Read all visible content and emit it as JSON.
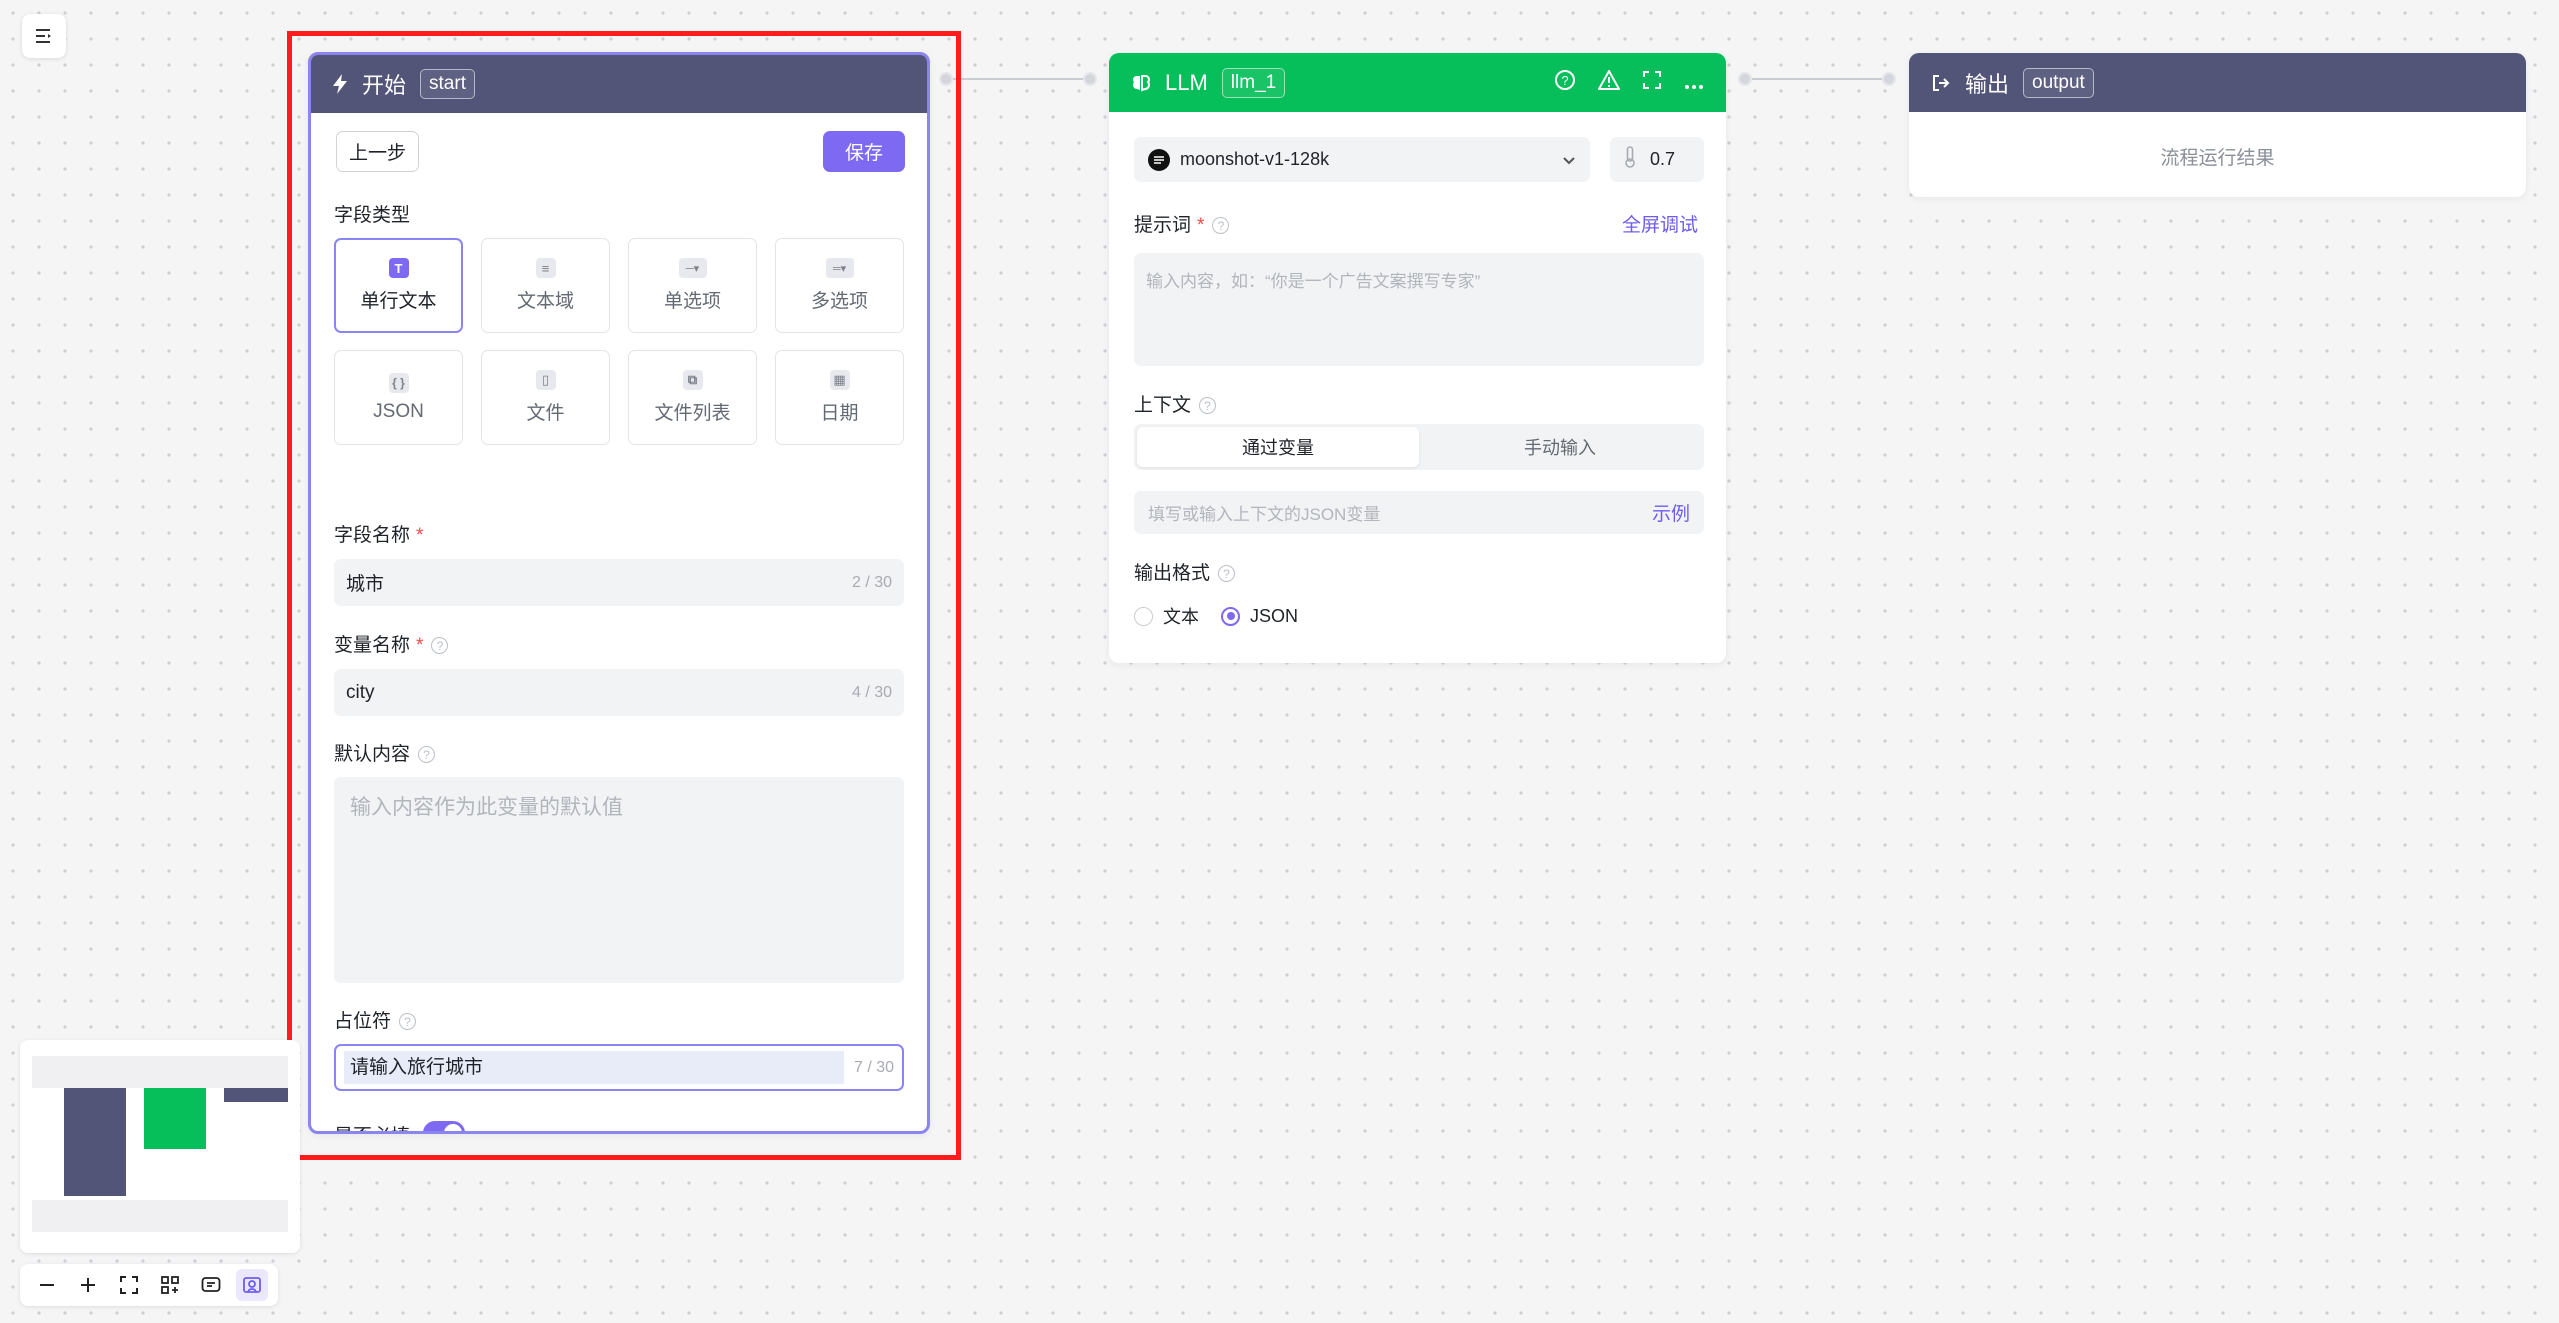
{
  "toolbar": {
    "menu_icon": "menu-list-icon"
  },
  "start_node": {
    "title": "开始",
    "tag": "start",
    "prev_label": "上一步",
    "save_label": "保存",
    "field_type_label": "字段类型",
    "field_types": [
      {
        "label": "单行文本",
        "icon": "T",
        "active": true
      },
      {
        "label": "文本域",
        "icon": "≡"
      },
      {
        "label": "单选项",
        "icon": "─▾"
      },
      {
        "label": "多选项",
        "icon": "═▾"
      },
      {
        "label": "JSON",
        "icon": "{ }"
      },
      {
        "label": "文件",
        "icon": "▯"
      },
      {
        "label": "文件列表",
        "icon": "⧉"
      },
      {
        "label": "日期",
        "icon": "▦"
      }
    ],
    "field_name_label": "字段名称",
    "field_name_value": "城市",
    "field_name_count": "2 / 30",
    "var_name_label": "变量名称",
    "var_name_value": "city",
    "var_name_count": "4 / 30",
    "default_label": "默认内容",
    "default_placeholder": "输入内容作为此变量的默认值",
    "placeholder_label": "占位符",
    "placeholder_value": "请输入旅行城市",
    "placeholder_count": "7 / 30",
    "required_label": "是否必填",
    "required_on": true
  },
  "llm_node": {
    "title": "LLM",
    "tag": "llm_1",
    "model": "moonshot-v1-128k",
    "temperature": "0.7",
    "prompt_label": "提示词",
    "fullscreen_debug": "全屏调试",
    "prompt_placeholder": "输入内容，如：“你是一个广告文案撰写专家”",
    "context_label": "上下文",
    "context_tabs": [
      "通过变量",
      "手动输入"
    ],
    "context_placeholder": "填写或输入上下文的JSON变量",
    "example_link": "示例",
    "output_format_label": "输出格式",
    "formats": [
      "文本",
      "JSON"
    ],
    "selected_format": "JSON"
  },
  "output_node": {
    "title": "输出",
    "tag": "output",
    "result_text": "流程运行结果"
  },
  "colors": {
    "start_header": "#525478",
    "llm_header": "#06be5a",
    "accent": "#7e69f2",
    "highlight": "#ff1c1c"
  }
}
